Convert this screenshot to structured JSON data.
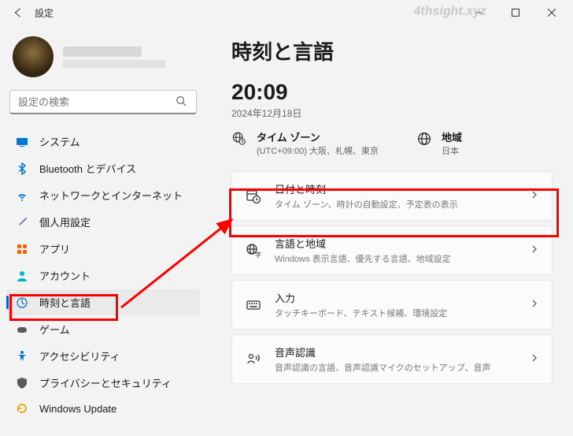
{
  "window": {
    "title": "設定",
    "watermark": "4thsight.xyz"
  },
  "profile": {},
  "search": {
    "placeholder": "設定の検索"
  },
  "sidebar": {
    "items": [
      {
        "label": "システム"
      },
      {
        "label": "Bluetooth とデバイス"
      },
      {
        "label": "ネットワークとインターネット"
      },
      {
        "label": "個人用設定"
      },
      {
        "label": "アプリ"
      },
      {
        "label": "アカウント"
      },
      {
        "label": "時刻と言語"
      },
      {
        "label": "ゲーム"
      },
      {
        "label": "アクセシビリティ"
      },
      {
        "label": "プライバシーとセキュリティ"
      },
      {
        "label": "Windows Update"
      }
    ],
    "selected_index": 6
  },
  "main": {
    "title": "時刻と言語",
    "clock": "20:09",
    "date": "2024年12月18日",
    "info": [
      {
        "label": "タイム ゾーン",
        "sub": "(UTC+09:00) 大阪、札幌、東京"
      },
      {
        "label": "地域",
        "sub": "日本"
      }
    ],
    "cards": [
      {
        "title": "日付と時刻",
        "sub": "タイム ゾーン、時計の自動設定、予定表の表示"
      },
      {
        "title": "言語と地域",
        "sub": "Windows 表示言語、優先する言語、地域設定"
      },
      {
        "title": "入力",
        "sub": "タッチキーボード、テキスト候補、環境設定"
      },
      {
        "title": "音声認識",
        "sub": "音声認識の言語、音声認識マイクのセットアップ、音声"
      }
    ]
  }
}
